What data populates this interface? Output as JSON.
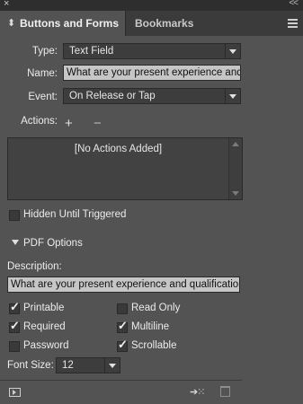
{
  "window": {
    "close_glyph": "×",
    "collapse_glyph": "<<"
  },
  "tabs": [
    {
      "label": "Buttons and Forms",
      "active": true
    },
    {
      "label": "Bookmarks",
      "active": false
    }
  ],
  "form": {
    "type": {
      "label": "Type:",
      "value": "Text Field"
    },
    "name": {
      "label": "Name:",
      "value": "What are your present experience and q"
    },
    "event": {
      "label": "Event:",
      "value": "On Release or Tap"
    },
    "actions": {
      "label": "Actions:",
      "add_glyph": "+",
      "remove_glyph": "−",
      "empty_text": "[No Actions Added]"
    },
    "hidden_until_triggered": {
      "label": "Hidden Until Triggered",
      "checked": false
    }
  },
  "pdf_options": {
    "title": "PDF Options",
    "description_label": "Description:",
    "description_value": "What are your present experience and qualifications",
    "checkboxes": {
      "printable": {
        "label": "Printable",
        "checked": true
      },
      "read_only": {
        "label": "Read Only",
        "checked": false
      },
      "required": {
        "label": "Required",
        "checked": true
      },
      "multiline": {
        "label": "Multiline",
        "checked": true
      },
      "password": {
        "label": "Password",
        "checked": false
      },
      "scrollable": {
        "label": "Scrollable",
        "checked": true
      }
    },
    "font_size": {
      "label": "Font Size:",
      "value": "12"
    }
  },
  "footer": {
    "icons": [
      "preview-icon",
      "convert-to-button-icon",
      "trash-icon"
    ]
  }
}
